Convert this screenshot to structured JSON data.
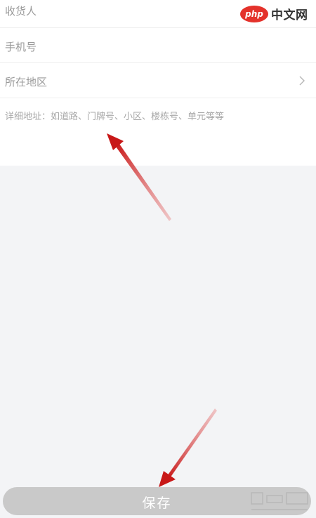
{
  "form": {
    "recipient_placeholder": "收货人",
    "phone_placeholder": "手机号",
    "region_label": "所在地区",
    "detail_placeholder": "详细地址：如道路、门牌号、小区、楼栋号、单元等等"
  },
  "watermark": {
    "logo_text": "php",
    "site_text": "中文网"
  },
  "save_button": {
    "label": "保存"
  },
  "colors": {
    "arrow": "#d42020",
    "button_bg": "#c9c9c9",
    "page_bg": "#f3f4f6"
  }
}
